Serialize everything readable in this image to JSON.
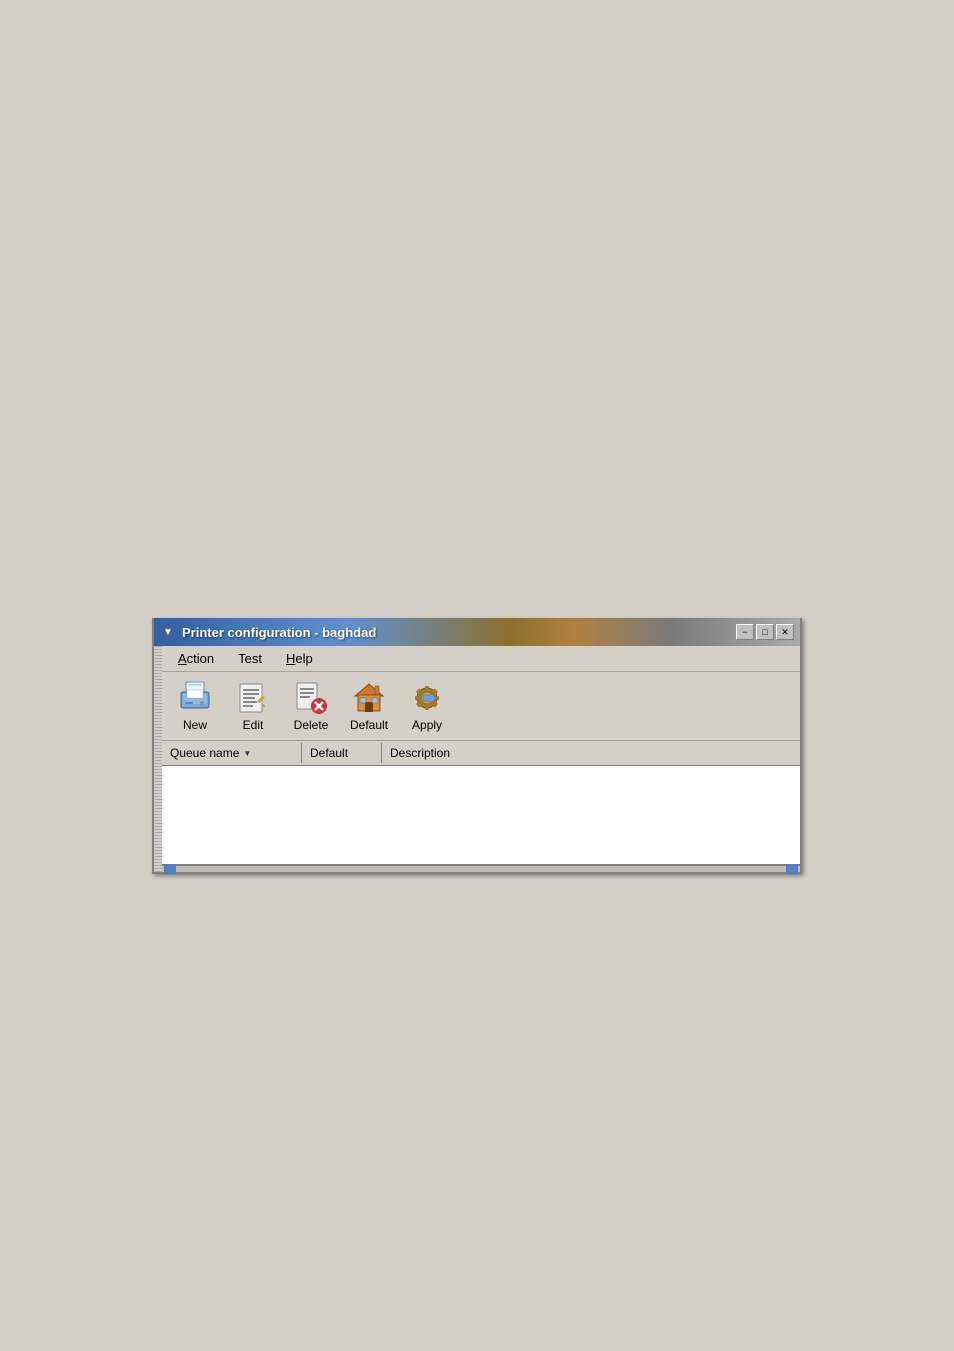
{
  "window": {
    "title": "Printer configuration - baghdad",
    "titlebar_icon": "▼",
    "min_label": "−",
    "max_label": "□",
    "close_label": "✕"
  },
  "menubar": {
    "items": [
      {
        "label": "Action",
        "underline_index": 0,
        "id": "action"
      },
      {
        "label": "Test",
        "underline_index": 0,
        "id": "test"
      },
      {
        "label": "Help",
        "underline_index": 0,
        "id": "help"
      }
    ]
  },
  "toolbar": {
    "items": [
      {
        "id": "new",
        "label": "New",
        "icon": "printer-icon"
      },
      {
        "id": "edit",
        "label": "Edit",
        "icon": "list-icon"
      },
      {
        "id": "delete",
        "label": "Delete",
        "icon": "delete-icon"
      },
      {
        "id": "default",
        "label": "Default",
        "icon": "home-icon"
      },
      {
        "id": "apply",
        "label": "Apply",
        "icon": "apply-icon"
      }
    ]
  },
  "table": {
    "columns": [
      {
        "id": "queue-name",
        "label": "Queue name",
        "has_dropdown": true
      },
      {
        "id": "default",
        "label": "Default",
        "has_dropdown": false
      },
      {
        "id": "description",
        "label": "Description",
        "has_dropdown": false
      }
    ],
    "rows": []
  }
}
